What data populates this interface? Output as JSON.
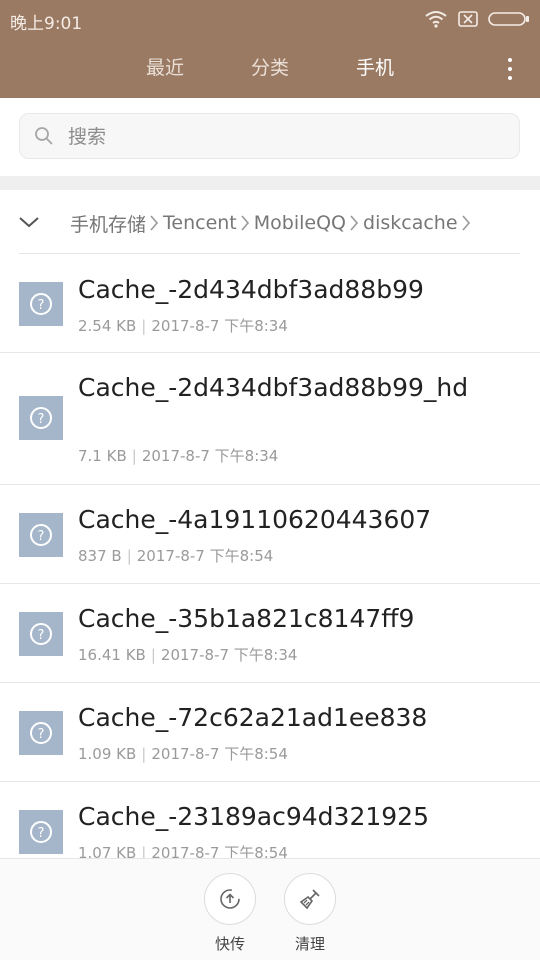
{
  "status_bar": {
    "time": "晚上9:01"
  },
  "tabs": [
    {
      "label": "最近",
      "active": false
    },
    {
      "label": "分类",
      "active": false
    },
    {
      "label": "手机",
      "active": true
    }
  ],
  "search": {
    "placeholder": "搜索"
  },
  "breadcrumb": [
    "手机存储",
    "Tencent",
    "MobileQQ",
    "diskcache"
  ],
  "files": [
    {
      "name": "Cache_-2d434dbf3ad88b99",
      "size": "2.54 KB",
      "date": "2017-8-7 下午8:34"
    },
    {
      "name": "Cache_-2d434dbf3ad88b99_hd",
      "size": "7.1 KB",
      "date": "2017-8-7 下午8:34"
    },
    {
      "name": "Cache_-4a19110620443607",
      "size": "837 B",
      "date": "2017-8-7 下午8:54"
    },
    {
      "name": "Cache_-35b1a821c8147ff9",
      "size": "16.41 KB",
      "date": "2017-8-7 下午8:34"
    },
    {
      "name": "Cache_-72c62a21ad1ee838",
      "size": "1.09 KB",
      "date": "2017-8-7 下午8:54"
    },
    {
      "name": "Cache_-23189ac94d321925",
      "size": "1.07 KB",
      "date": "2017-8-7 下午8:54"
    }
  ],
  "bottom_actions": [
    {
      "label": "快传",
      "icon": "fast-transfer-icon"
    },
    {
      "label": "清理",
      "icon": "broom-icon"
    }
  ],
  "colors": {
    "header": "#9a7a63",
    "file_icon": "#a5b6cb"
  }
}
